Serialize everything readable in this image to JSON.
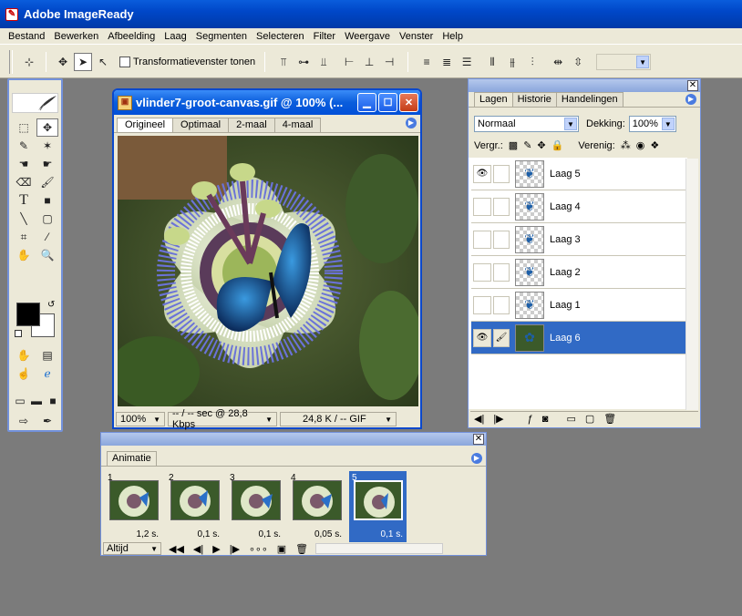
{
  "app": {
    "title": "Adobe ImageReady"
  },
  "menu": [
    "Bestand",
    "Bewerken",
    "Afbeelding",
    "Laag",
    "Segmenten",
    "Selecteren",
    "Filter",
    "Weergave",
    "Venster",
    "Help"
  ],
  "options": {
    "transform_label": "Transformatievenster tonen"
  },
  "document": {
    "title": "vlinder7-groot-canvas.gif @ 100% (...",
    "tabs": [
      "Origineel",
      "Optimaal",
      "2-maal",
      "4-maal"
    ],
    "zoom": "100%",
    "speed": "-- / -- sec @ 28,8 Kbps",
    "size": "24,8 K / -- GIF"
  },
  "layers_panel": {
    "tabs": [
      "Lagen",
      "Historie",
      "Handelingen"
    ],
    "blend_mode": "Normaal",
    "opacity_label": "Dekking:",
    "opacity": "100%",
    "lock_label": "Vergr.:",
    "unify_label": "Verenig:",
    "layers": [
      {
        "name": "Laag 5",
        "visible": true,
        "selected": false
      },
      {
        "name": "Laag 4",
        "visible": false,
        "selected": false
      },
      {
        "name": "Laag 3",
        "visible": false,
        "selected": false
      },
      {
        "name": "Laag 2",
        "visible": false,
        "selected": false
      },
      {
        "name": "Laag 1",
        "visible": false,
        "selected": false
      },
      {
        "name": "Laag 6",
        "visible": true,
        "selected": true
      }
    ]
  },
  "animation_panel": {
    "tab": "Animatie",
    "loop": "Altijd",
    "frames": [
      {
        "num": "1",
        "delay": "1,2 s."
      },
      {
        "num": "2",
        "delay": "0,1 s."
      },
      {
        "num": "3",
        "delay": "0,1 s."
      },
      {
        "num": "4",
        "delay": "0,05 s."
      },
      {
        "num": "5",
        "delay": "0,1 s."
      }
    ]
  },
  "colors": {
    "xp_blue": "#0a5ddc",
    "selection": "#316ac5",
    "panel": "#ece9d8",
    "desktop": "#7b7b7b"
  }
}
